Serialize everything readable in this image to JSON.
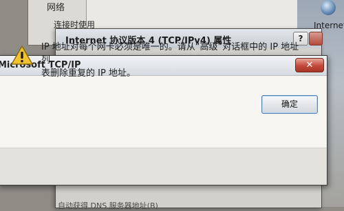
{
  "background_window": {
    "network_label": "网络",
    "connect_label": "连接时使用"
  },
  "desktop": {
    "internet_label": "Internet",
    "network_icon": "globe-icon"
  },
  "properties_window": {
    "title": "Internet 协议版本 4 (TCP/IPv4) 属性",
    "help_label": "?",
    "bottom_text": "自动获得 DNS 服务器地址(B)"
  },
  "dialog": {
    "title": "Microsoft TCP/IP",
    "close_label": "✕",
    "icon": "warning-icon",
    "message": "IP 地址对每个网卡必须是唯一的。请从“高级”对话框中的 IP 地址列\n表删除重复的 IP 地址。",
    "ok_label": "确定"
  },
  "colors": {
    "warning_yellow": "#f2c230",
    "close_red": "#c2493a",
    "focus_blue": "#4d81b8"
  }
}
